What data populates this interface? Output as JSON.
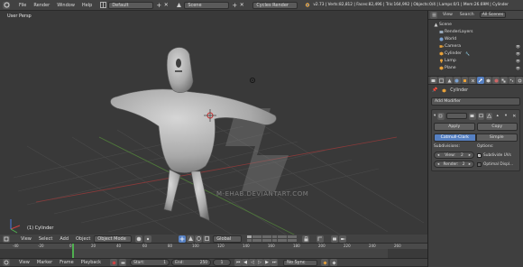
{
  "info_header": {
    "menu": [
      "File",
      "Render",
      "Window",
      "Help"
    ],
    "screen_layout": "Default",
    "scene": "Scene",
    "engine": "Cycles Render",
    "stats": "v2.73 | Verts:82,812 | Faces:82,496 | Tris:164,992 | Objects:0/4 | Lamps:0/1 | Mem:26.69M | Cylinder"
  },
  "viewport": {
    "view_label": "User Persp",
    "object_label": "(1) Cylinder",
    "watermark": "M-EHAB.DEVIANTART.COM"
  },
  "view3d_header": {
    "menu": [
      "View",
      "Select",
      "Add",
      "Object"
    ],
    "mode": "Object Mode",
    "orientation": "Global"
  },
  "outliner": {
    "tabs": [
      "View",
      "Search",
      "All Scenes"
    ],
    "items": [
      {
        "label": "Scene",
        "icon": "scene-icon"
      },
      {
        "label": "RenderLayers",
        "icon": "render-layers-icon"
      },
      {
        "label": "World",
        "icon": "world-icon"
      },
      {
        "label": "Camera",
        "icon": "camera-icon"
      },
      {
        "label": "Cylinder",
        "icon": "mesh-icon"
      },
      {
        "label": "Lamp",
        "icon": "lamp-icon"
      },
      {
        "label": "Plane",
        "icon": "mesh-icon"
      }
    ]
  },
  "properties": {
    "object_name": "Cylinder",
    "add_modifier": "Add Modifier",
    "apply": "Apply",
    "copy": "Copy",
    "catmull_clark": "Catmull-Clark",
    "simple": "Simple",
    "subdivisions_label": "Subdivisions:",
    "options_label": "Options:",
    "view_label": "View:",
    "view_value": "2",
    "render_label": "Render:",
    "render_value": "2",
    "subdivide_uvs": "Subdivide UVs",
    "optimal_display": "Optimal Displ..."
  },
  "timeline": {
    "ticks": [
      "-40",
      "-20",
      "0",
      "20",
      "40",
      "60",
      "80",
      "100",
      "120",
      "140",
      "160",
      "180",
      "200",
      "220",
      "240",
      "260"
    ],
    "menu": [
      "View",
      "Marker",
      "Frame",
      "Playback"
    ],
    "start_label": "Start:",
    "start_value": "1",
    "end_label": "End:",
    "end_value": "250",
    "current_frame": "1",
    "sync": "No Sync"
  },
  "colors": {
    "accent_blue": "#5680c2",
    "orange": "#e8a23a",
    "header_gray": "#424242",
    "timeline_green": "#4fb04f"
  }
}
